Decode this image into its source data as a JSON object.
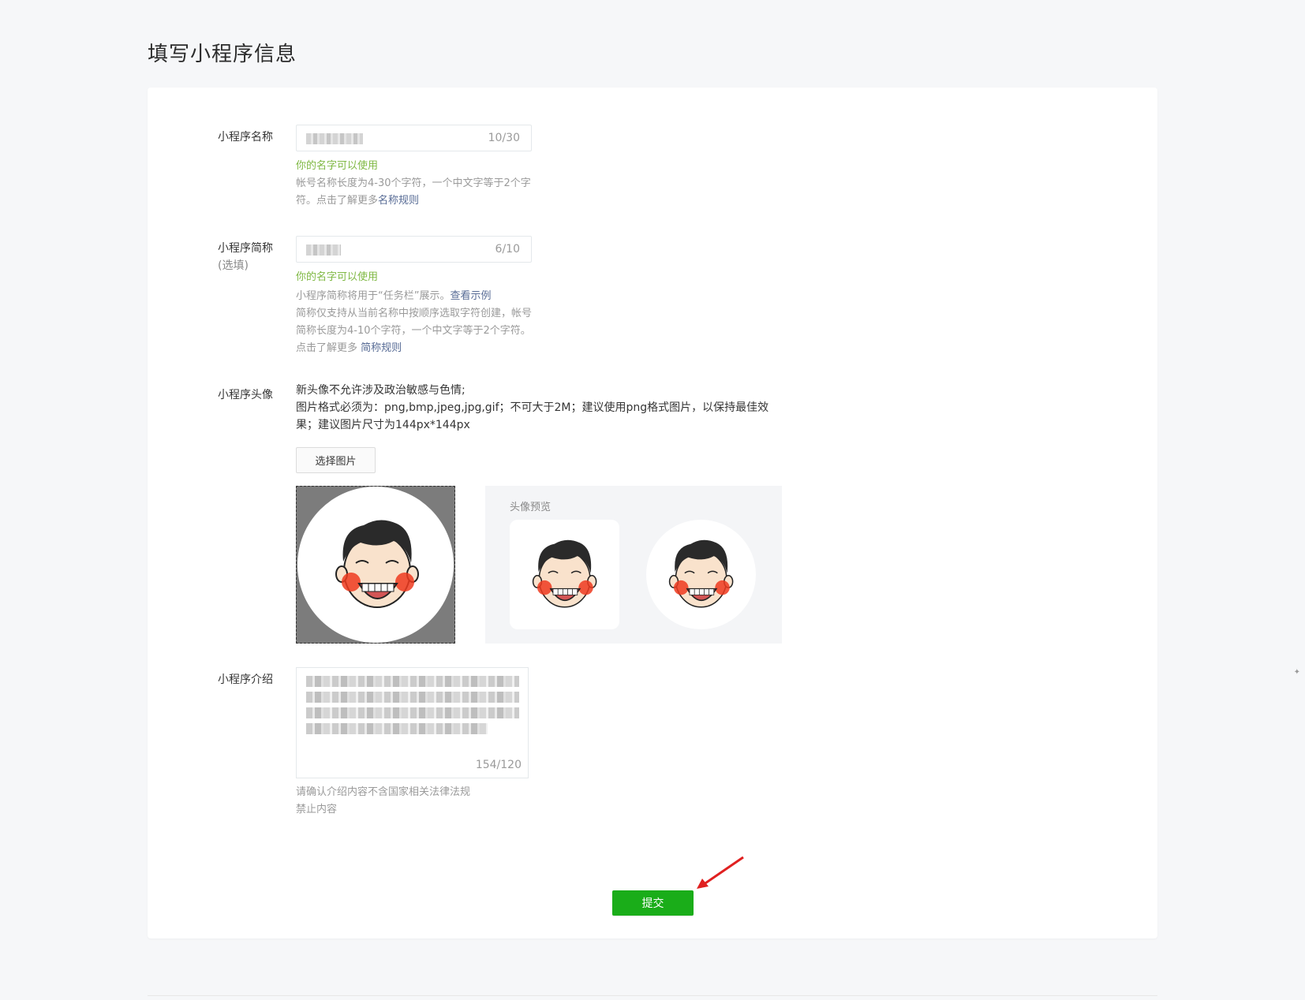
{
  "page": {
    "title": "填写小程序信息"
  },
  "name_field": {
    "label": "小程序名称",
    "counter": "10/30",
    "ok_msg": "你的名字可以使用",
    "tip_prefix": "帐号名称长度为4-30个字符，一个中文字等于2个字符。点击了解更多",
    "tip_link": "名称规则"
  },
  "short_name_field": {
    "label": "小程序简称",
    "sub_label": "(选填)",
    "counter": "6/10",
    "ok_msg": "你的名字可以使用",
    "tip_line1_prefix": "小程序简称将用于“任务栏”展示。",
    "tip_line1_link": "查看示例",
    "tip_body": "简称仅支持从当前名称中按顺序选取字符创建，帐号简称长度为4-10个字符，一个中文字等于2个字符。点击了解更多 ",
    "tip_link": "简称规则"
  },
  "avatar_field": {
    "label": "小程序头像",
    "desc_line1": "新头像不允许涉及政治敏感与色情;",
    "desc_line2": "图片格式必须为：png,bmp,jpeg,jpg,gif；不可大于2M；建议使用png格式图片，以保持最佳效果；建议图片尺寸为144px*144px",
    "choose_button": "选择图片",
    "preview_title": "头像预览"
  },
  "intro_field": {
    "label": "小程序介绍",
    "counter": "154/120",
    "tip_line1": "请确认介绍内容不含国家相关法律法规",
    "tip_line2": "禁止内容"
  },
  "submit": {
    "label": "提交"
  },
  "colors": {
    "accent_green": "#1aad19",
    "ok_green": "#7fb843",
    "link_blue": "#576b95",
    "annotation_arrow": "#e02020"
  },
  "icons": {
    "side": "pin-icon"
  }
}
